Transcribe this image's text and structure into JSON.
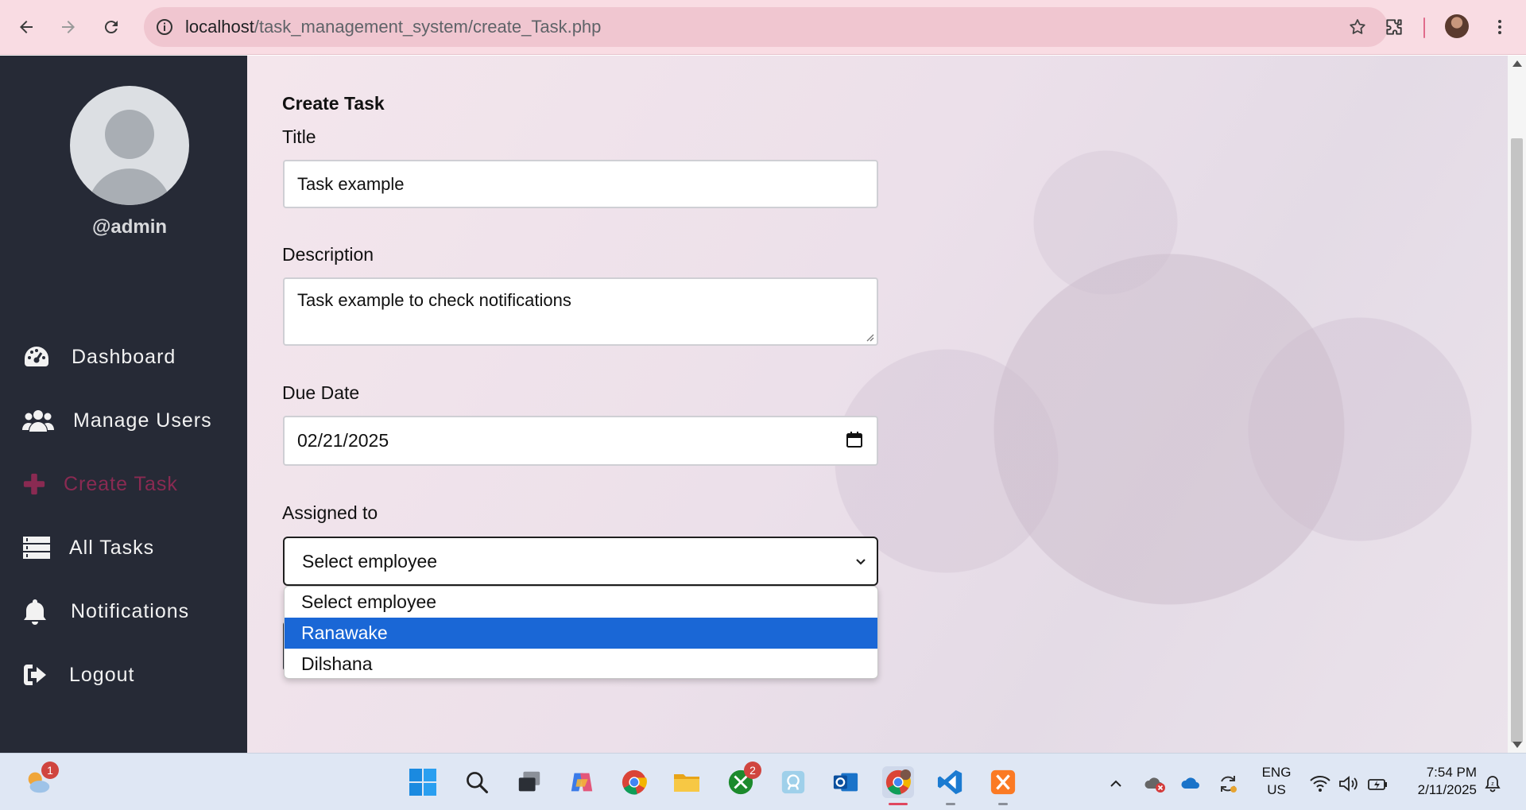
{
  "browser": {
    "url_host": "localhost",
    "url_path": "/task_management_system/create_Task.php"
  },
  "sidebar": {
    "username": "@admin",
    "items": [
      {
        "label": "Dashboard",
        "icon": "gauge-icon"
      },
      {
        "label": "Manage Users",
        "icon": "users-icon"
      },
      {
        "label": "Create Task",
        "icon": "plus-icon",
        "active": true
      },
      {
        "label": "All Tasks",
        "icon": "list-icon"
      },
      {
        "label": "Notifications",
        "icon": "bell-icon"
      },
      {
        "label": "Logout",
        "icon": "logout-icon"
      }
    ],
    "active_color": "#8a2a52"
  },
  "form": {
    "heading": "Create Task",
    "title_label": "Title",
    "title_value": "Task example",
    "description_label": "Description",
    "description_value": "Task example to check notifications",
    "due_date_label": "Due Date",
    "due_date_value": "02/21/2025",
    "assigned_label": "Assigned to",
    "assigned_selected": "Select employee",
    "assigned_options": [
      "Select employee",
      "Ranawake",
      "Dilshana"
    ],
    "highlighted_option": "Ranawake",
    "highlight_color": "#1a67d6"
  },
  "taskbar": {
    "weather_badge": "1",
    "xbox_badge": "2",
    "language": "ENG",
    "region": "US",
    "time": "7:54 PM",
    "date": "2/11/2025"
  }
}
